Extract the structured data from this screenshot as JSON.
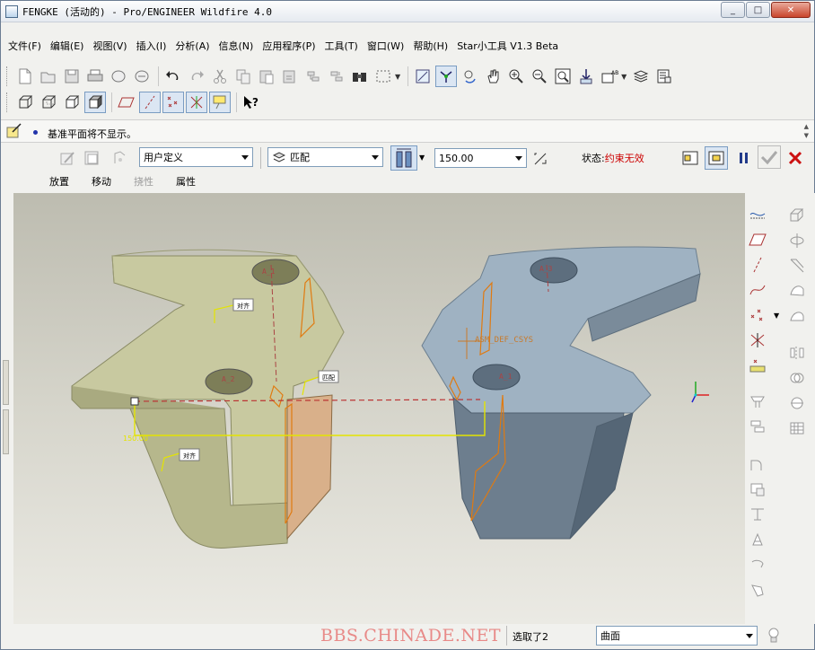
{
  "window": {
    "title": "FENGKE (活动的) - Pro/ENGINEER Wildfire 4.0",
    "controls": {
      "minimize": "_",
      "maximize": "□",
      "close": "✕"
    }
  },
  "menubar": {
    "items": [
      "文件(F)",
      "编辑(E)",
      "视图(V)",
      "插入(I)",
      "分析(A)",
      "信息(N)",
      "应用程序(P)",
      "工具(T)",
      "窗口(W)",
      "帮助(H)",
      "Star小工具 V1.3 Beta"
    ]
  },
  "message": {
    "text": "基准平面将不显示。"
  },
  "dashboard": {
    "constraint_set": "用户定义",
    "constraint_type": "匹配",
    "offset_value": "150.00",
    "status_label": "状态:",
    "status_value": "约束无效",
    "tabs": [
      {
        "label": "放置",
        "enabled": true
      },
      {
        "label": "移动",
        "enabled": true
      },
      {
        "label": "挠性",
        "enabled": false
      },
      {
        "label": "属性",
        "enabled": true
      }
    ]
  },
  "graphics": {
    "labels": {
      "axis_a1_top_left": "A_1",
      "axis_a2_left": "A_2",
      "axis_a3_right": "A_3",
      "axis_a1_right": "A_1",
      "csys": "ASM_DEF_CSYS",
      "align_1": "对齐",
      "align_2": "对齐",
      "mate": "匹配",
      "dimension": "150.00"
    },
    "colors": {
      "left_part": "#c8c9a0",
      "right_part": "#9fb2c2",
      "constraint": "#e07a10",
      "dimension": "#e4e400"
    }
  },
  "statusbar": {
    "watermark": "BBS.CHINADE.NET",
    "selected": "选取了2",
    "filter": "曲面"
  }
}
